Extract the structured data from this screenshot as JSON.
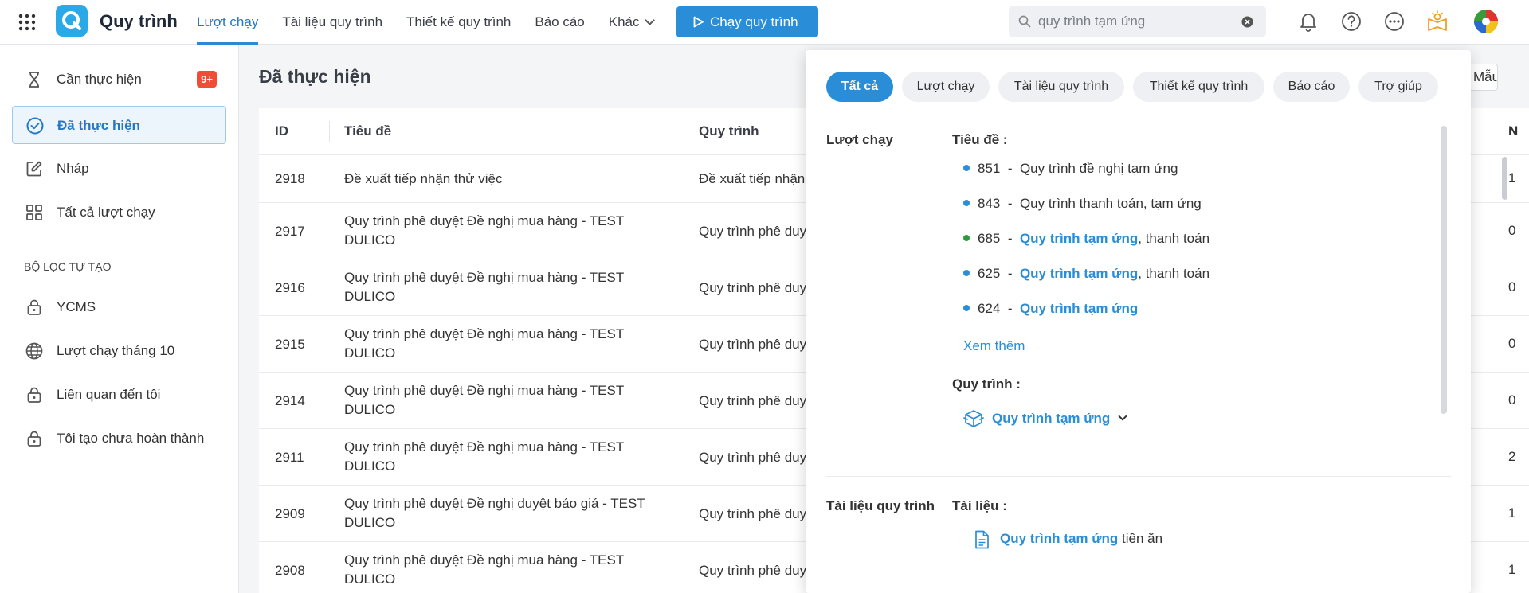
{
  "app": {
    "title": "Quy trình"
  },
  "nav": [
    {
      "label": "Lượt chạy",
      "active": true
    },
    {
      "label": "Tài liệu quy trình"
    },
    {
      "label": "Thiết kế quy trình"
    },
    {
      "label": "Báo cáo"
    },
    {
      "label": "Khác"
    }
  ],
  "run_button": {
    "label": "Chạy quy trình"
  },
  "search": {
    "value": "quy trình tạm ứng"
  },
  "sidebar": {
    "items": [
      {
        "label": "Cần thực hiện",
        "icon": "hourglass-icon",
        "badge": "9+"
      },
      {
        "label": "Đã thực hiện",
        "icon": "check-circle-icon",
        "active": true
      },
      {
        "label": "Nháp",
        "icon": "edit-icon"
      },
      {
        "label": "Tất cả lượt chạy",
        "icon": "grid-icon"
      }
    ],
    "section_title": "BỘ LỌC TỰ TẠO",
    "filters": [
      {
        "label": "YCMS",
        "icon": "lock-icon"
      },
      {
        "label": "Lượt chạy tháng 10",
        "icon": "globe-icon"
      },
      {
        "label": "Liên quan đến tôi",
        "icon": "lock-icon"
      },
      {
        "label": "Tôi tạo chưa hoàn thành",
        "icon": "lock-icon"
      }
    ]
  },
  "main": {
    "title": "Đã thực hiện",
    "partial_button": "Mẫu",
    "columns": [
      "ID",
      "Tiêu đề",
      "Quy trình"
    ],
    "rows": [
      {
        "id": "2918",
        "title": "Đề xuất tiếp nhận thử việc",
        "workflow": "Đề xuất tiếp nhận",
        "edge": "1"
      },
      {
        "id": "2917",
        "title": "Quy trình phê duyệt Đề nghị mua hàng - TEST DULICO",
        "workflow": "Quy trình phê duy",
        "edge": "0"
      },
      {
        "id": "2916",
        "title": "Quy trình phê duyệt Đề nghị mua hàng - TEST DULICO",
        "workflow": "Quy trình phê duy",
        "edge": "0"
      },
      {
        "id": "2915",
        "title": "Quy trình phê duyệt Đề nghị mua hàng - TEST DULICO",
        "workflow": "Quy trình phê duy",
        "edge": "0"
      },
      {
        "id": "2914",
        "title": "Quy trình phê duyệt Đề nghị mua hàng - TEST DULICO",
        "workflow": "Quy trình phê duy",
        "edge": "0"
      },
      {
        "id": "2911",
        "title": "Quy trình phê duyệt Đề nghị mua hàng - TEST DULICO",
        "workflow": "Quy trình phê duy",
        "edge": "2"
      },
      {
        "id": "2909",
        "title": "Quy trình phê duyệt Đề nghị duyệt báo giá - TEST DULICO",
        "workflow": "Quy trình phê duy",
        "edge": "1"
      },
      {
        "id": "2908",
        "title": "Quy trình phê duyệt Đề nghị mua hàng - TEST DULICO",
        "workflow": "Quy trình phê duy",
        "edge": "1"
      }
    ]
  },
  "panel": {
    "tabs": [
      "Tất cả",
      "Lượt chạy",
      "Tài liệu quy trình",
      "Thiết kế quy trình",
      "Báo cáo",
      "Trợ giúp"
    ],
    "runs": {
      "section_label": "Lượt chạy",
      "title_label": "Tiêu đề :",
      "results": [
        {
          "num": "851",
          "pre": "Quy trình đề nghị tạm ứng",
          "hl": "",
          "post": ""
        },
        {
          "num": "843",
          "pre": "Quy trình thanh toán, tạm ứng",
          "hl": "",
          "post": ""
        },
        {
          "num": "685",
          "pre": "",
          "hl": "Quy trình tạm ứng",
          "post": ", thanh toán",
          "dot": "green"
        },
        {
          "num": "625",
          "pre": "",
          "hl": "Quy trình tạm ứng",
          "post": ", thanh toán"
        },
        {
          "num": "624",
          "pre": "",
          "hl": "Quy trình tạm ứng",
          "post": ""
        }
      ],
      "see_more": "Xem thêm",
      "workflow_label": "Quy trình :",
      "workflow_value": "Quy trình tạm ứng"
    },
    "docs": {
      "section_label": "Tài liệu quy trình",
      "doc_label": "Tài liệu :",
      "doc_hl": "Quy trình tạm ứng",
      "doc_rest": " tiền ăn"
    }
  },
  "colors": {
    "accent": "#2a8dd8",
    "badge": "#ef4d36",
    "active_bg": "#edf5fc"
  }
}
